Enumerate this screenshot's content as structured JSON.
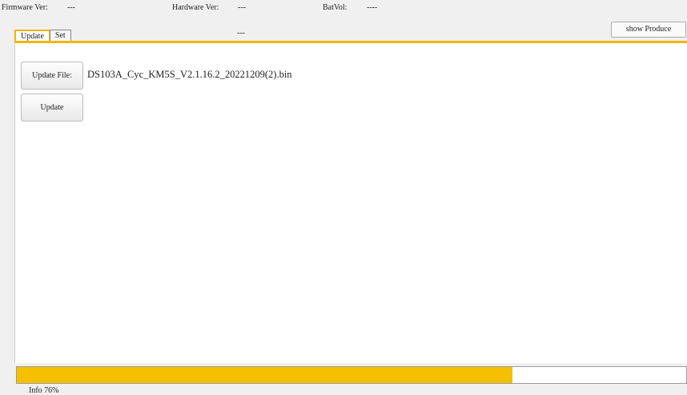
{
  "info": {
    "firmware_label": "Firmware Ver:",
    "firmware_value": "---",
    "hardware_label": "Hardware Ver:",
    "hardware_value": "---",
    "batvol_label": "BatVol:",
    "batvol_value": "----"
  },
  "tabs": [
    {
      "label": "Update"
    },
    {
      "label": "Set"
    }
  ],
  "top_placeholder": "---",
  "show_produce_label": "show Produce",
  "update": {
    "file_button_label": "Update File:",
    "file_name": "DS103A_Cyc_KM5S_V2.1.16.2_20221209(2).bin",
    "update_button_label": "Update"
  },
  "progress": {
    "fraction": 0.74,
    "status_text": "Info 76%"
  },
  "colors": {
    "accent": "#f5c000"
  }
}
